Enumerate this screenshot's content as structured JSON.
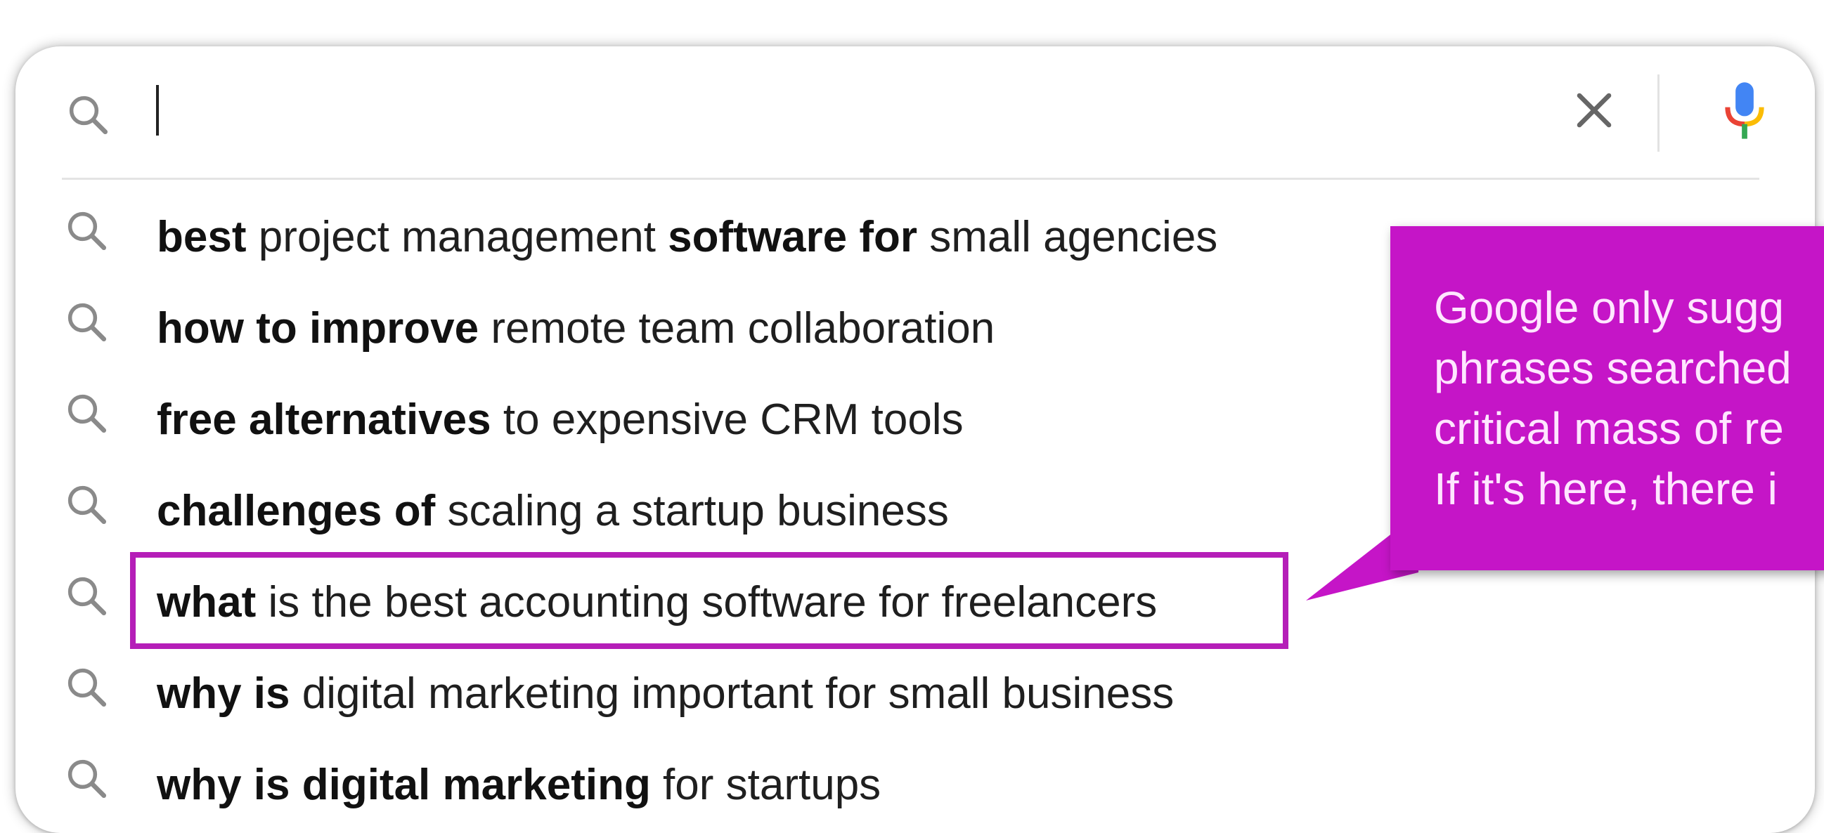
{
  "search": {
    "value": "",
    "clear_icon": "close-icon",
    "voice_icon": "microphone-icon"
  },
  "suggestions": [
    {
      "parts": [
        {
          "t": "best",
          "b": true
        },
        {
          "t": " project management ",
          "b": false
        },
        {
          "t": "software for",
          "b": true
        },
        {
          "t": " small agencies",
          "b": false
        }
      ]
    },
    {
      "parts": [
        {
          "t": "how to improve",
          "b": true
        },
        {
          "t": " remote team collaboration",
          "b": false
        }
      ]
    },
    {
      "parts": [
        {
          "t": "free",
          "b": true
        },
        {
          "t": " ",
          "b": false
        },
        {
          "t": "alternatives",
          "b": true
        },
        {
          "t": " to expensive CRM tools",
          "b": false
        }
      ]
    },
    {
      "parts": [
        {
          "t": "challenges of",
          "b": true
        },
        {
          "t": " scaling a startup business",
          "b": false
        }
      ]
    },
    {
      "parts": [
        {
          "t": "what",
          "b": true
        },
        {
          "t": " is the best accounting software for freelancers",
          "b": false
        }
      ]
    },
    {
      "parts": [
        {
          "t": "why is",
          "b": true
        },
        {
          "t": " digital marketing important for small business",
          "b": false
        }
      ]
    },
    {
      "parts": [
        {
          "t": "why is digital marketing",
          "b": true
        },
        {
          "t": " for startups",
          "b": false
        }
      ]
    }
  ],
  "highlighted_index": 4,
  "callout": {
    "lines": [
      "Google only sugg",
      "phrases searched",
      "critical mass of re",
      "If it's here, there i"
    ]
  },
  "colors": {
    "callout": "#c515c7",
    "highlight_border": "#b51eb8",
    "mic_blue": "#4285f4",
    "mic_red": "#ea4335",
    "mic_yellow": "#fbbc05",
    "mic_green": "#34a853"
  }
}
